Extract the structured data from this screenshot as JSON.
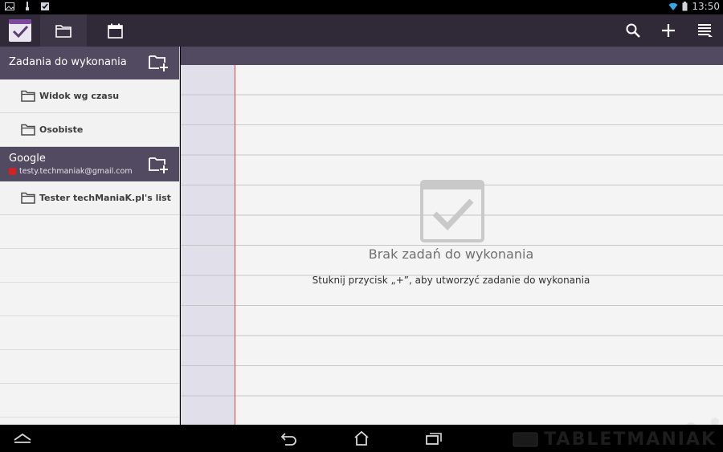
{
  "status_bar": {
    "time": "13:50",
    "left_icons": [
      "image-icon",
      "usb-icon",
      "clipboard-check-icon"
    ],
    "right_icons": [
      "wifi-icon",
      "battery-icon"
    ]
  },
  "action_bar": {
    "app_icon": "tasks-check-icon",
    "tabs": [
      {
        "icon": "folder-icon",
        "active": true
      },
      {
        "icon": "calendar-icon",
        "active": false
      }
    ],
    "actions": [
      "search-icon",
      "plus-icon",
      "menu-overflow-icon"
    ]
  },
  "sidebar": {
    "groups": [
      {
        "title": "Zadania do wykonania",
        "lists": [
          "Widok wg czasu",
          "Osobiste"
        ]
      },
      {
        "title": "Google",
        "account": "testy.techmaniak@gmail.com",
        "account_color": "#d42222",
        "lists": [
          "Tester techManiaK.pl's list"
        ]
      }
    ]
  },
  "main": {
    "empty_title": "Brak zadań do wykonania",
    "empty_hint": "Stuknij przycisk „+”, aby utworzyć zadanie do wykonania"
  },
  "nav_bar": {
    "buttons": [
      "collapse-icon",
      "back-icon",
      "home-icon",
      "recent-apps-icon"
    ]
  },
  "watermark": "TABLETMANIAK",
  "colors": {
    "action_bar": "#302a38",
    "header_purple": "#524a60",
    "margin_line": "#cf4b4b"
  }
}
